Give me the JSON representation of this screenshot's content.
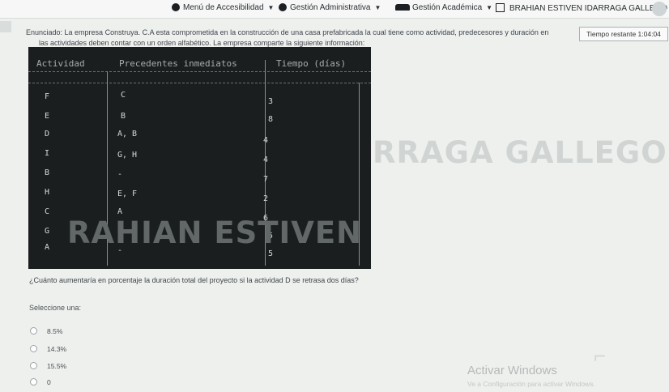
{
  "topbar": {
    "accessibility_menu": "Menú de Accesibilidad",
    "admin_menu": "Gestión Administrativa",
    "academic_menu": "Gestión Académica",
    "user_name": "BRAHIAN ESTIVEN IDARRAGA GALLEGO"
  },
  "statement": {
    "line1": "Enunciado: La empresa Construya. C.A esta comprometida en la construcción de una casa prefabricada la cual tiene como actividad, predecesores y duración en",
    "line2": "las actividades deben contar con un orden alfabético. La empresa comparte la siguiente información:"
  },
  "timer": "Tiempo restante 1:04:04",
  "table": {
    "headers": [
      "Actividad",
      "Precedentes inmediatos",
      "Tiempo (días)"
    ],
    "rows": [
      {
        "activity": "F",
        "preds": "C",
        "time": "3"
      },
      {
        "activity": "E",
        "preds": "B",
        "time": "8"
      },
      {
        "activity": "D",
        "preds": "A, B",
        "time": "4"
      },
      {
        "activity": "I",
        "preds": "G, H",
        "time": "4"
      },
      {
        "activity": "B",
        "preds": "-",
        "time": "7"
      },
      {
        "activity": "H",
        "preds": "E, F",
        "time": "2"
      },
      {
        "activity": "C",
        "preds": "A",
        "time": "6"
      },
      {
        "activity": "G",
        "preds": "D",
        "time": "5"
      },
      {
        "activity": "A",
        "preds": "-",
        "time": "5"
      }
    ]
  },
  "watermark": {
    "left": "RAHIAN ESTIVEN ID",
    "right": "RRAGA GALLEGO"
  },
  "question": "¿Cuánto aumentaría en porcentaje la duración total del proyecto si la actividad D se retrasa dos días?",
  "select_label": "Seleccione una:",
  "options": [
    "8.5%",
    "14.3%",
    "15.5%",
    "0"
  ],
  "windows": {
    "title": "Activar Windows",
    "subtitle": "Ve a Configuración para activar Windows."
  }
}
